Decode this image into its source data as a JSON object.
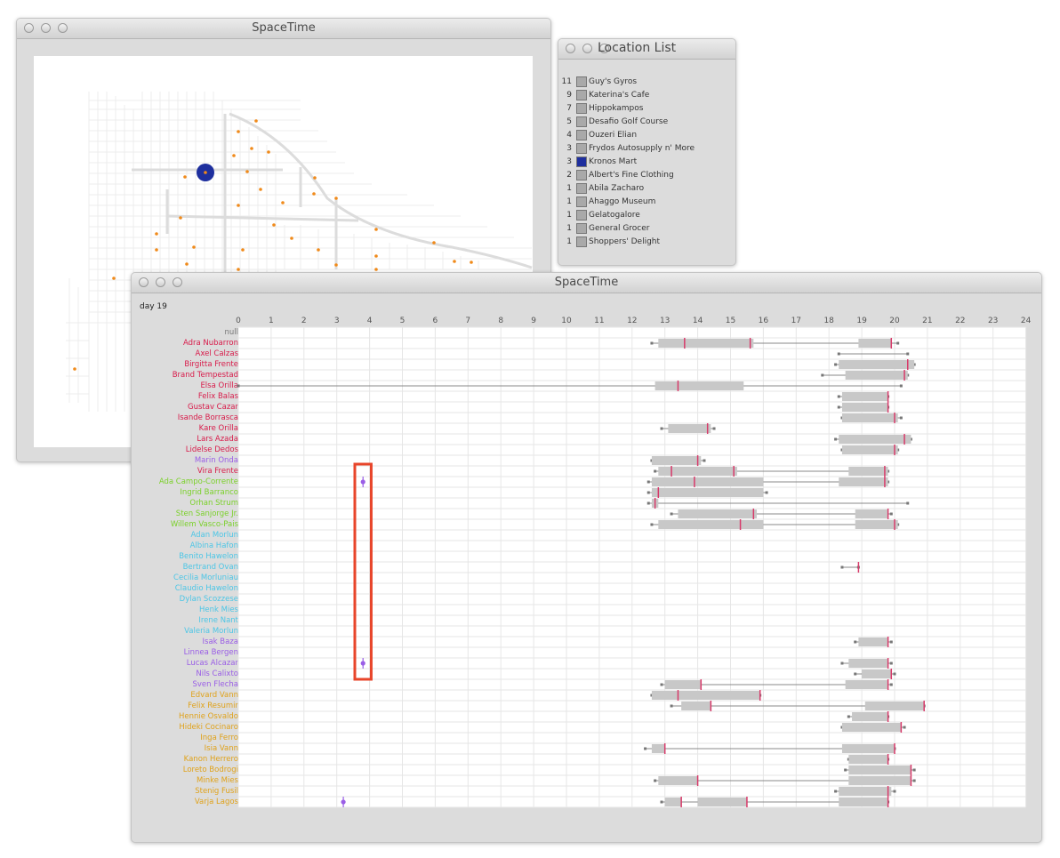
{
  "map_window": {
    "title": "SpaceTime"
  },
  "location_window": {
    "title": "Location List",
    "items": [
      {
        "count": "11",
        "name": "Guy's Gyros",
        "selected": false
      },
      {
        "count": "9",
        "name": "Katerina's Cafe",
        "selected": false
      },
      {
        "count": "7",
        "name": "Hippokampos",
        "selected": false
      },
      {
        "count": "5",
        "name": "Desafio Golf Course",
        "selected": false
      },
      {
        "count": "4",
        "name": "Ouzeri Elian",
        "selected": false
      },
      {
        "count": "3",
        "name": "Frydos Autosupply n' More",
        "selected": false
      },
      {
        "count": "3",
        "name": "Kronos Mart",
        "selected": true
      },
      {
        "count": "2",
        "name": "Albert's Fine Clothing",
        "selected": false
      },
      {
        "count": "1",
        "name": "Abila Zacharo",
        "selected": false
      },
      {
        "count": "1",
        "name": "Ahaggo Museum",
        "selected": false
      },
      {
        "count": "1",
        "name": "Gelatogalore",
        "selected": false
      },
      {
        "count": "1",
        "name": "General Grocer",
        "selected": false
      },
      {
        "count": "1",
        "name": "Shoppers' Delight",
        "selected": false
      }
    ]
  },
  "timeline_window": {
    "title": "SpaceTime",
    "day_label": "day 19",
    "hours": [
      "0",
      "1",
      "2",
      "3",
      "4",
      "5",
      "6",
      "7",
      "8",
      "9",
      "10",
      "11",
      "12",
      "13",
      "14",
      "15",
      "16",
      "17",
      "18",
      "19",
      "20",
      "21",
      "22",
      "23",
      "24"
    ],
    "colors": {
      "red": "#d81b4a",
      "green": "#7bd12a",
      "cyan": "#4cc6e6",
      "purple": "#9a5ee6",
      "orange": "#e0a21a",
      "null": "#777777",
      "highlight": "#e8452a",
      "bar": "#c8c8c8",
      "marker": "#d83a6a",
      "selected": "#1e2f9e"
    },
    "rows": [
      {
        "name": "null",
        "color": "null",
        "bars": [],
        "ticks": [],
        "line": []
      },
      {
        "name": "Adra Nubarron",
        "color": "red",
        "bars": [
          [
            12.8,
            15.7
          ],
          [
            18.9,
            19.9
          ]
        ],
        "ticks": [
          13.6,
          15.6,
          19.9
        ],
        "line": [
          12.6,
          20.1
        ]
      },
      {
        "name": "Axel Calzas",
        "color": "red",
        "bars": [],
        "ticks": [],
        "line": [
          18.3,
          20.4
        ]
      },
      {
        "name": "Birgitta Frente",
        "color": "red",
        "bars": [
          [
            18.3,
            20.6
          ]
        ],
        "ticks": [
          20.4
        ],
        "line": [
          18.2,
          20.6
        ]
      },
      {
        "name": "Brand Tempestad",
        "color": "red",
        "bars": [
          [
            18.5,
            20.4
          ]
        ],
        "ticks": [
          20.3
        ],
        "line": [
          17.8,
          20.4
        ]
      },
      {
        "name": "Elsa Orilla",
        "color": "red",
        "bars": [
          [
            12.7,
            15.4
          ]
        ],
        "ticks": [
          13.4
        ],
        "line": [
          0.0,
          20.2
        ]
      },
      {
        "name": "Felix Balas",
        "color": "red",
        "bars": [
          [
            18.4,
            19.8
          ]
        ],
        "ticks": [
          19.8
        ],
        "line": [
          18.3,
          19.8
        ]
      },
      {
        "name": "Gustav Cazar",
        "color": "red",
        "bars": [
          [
            18.4,
            19.8
          ]
        ],
        "ticks": [
          19.8
        ],
        "line": [
          18.3,
          19.8
        ]
      },
      {
        "name": "Isande Borrasca",
        "color": "red",
        "bars": [
          [
            18.4,
            20.1
          ]
        ],
        "ticks": [
          20.0
        ],
        "line": [
          18.4,
          20.2
        ]
      },
      {
        "name": "Kare Orilla",
        "color": "red",
        "bars": [
          [
            13.1,
            14.4
          ]
        ],
        "ticks": [
          14.3
        ],
        "line": [
          12.9,
          14.5
        ]
      },
      {
        "name": "Lars Azada",
        "color": "red",
        "bars": [
          [
            18.3,
            20.5
          ]
        ],
        "ticks": [
          20.3
        ],
        "line": [
          18.2,
          20.5
        ]
      },
      {
        "name": "Lidelse Dedos",
        "color": "red",
        "bars": [
          [
            18.4,
            20.1
          ]
        ],
        "ticks": [
          20.0
        ],
        "line": [
          18.4,
          20.1
        ]
      },
      {
        "name": "Marin Onda",
        "color": "purple",
        "bars": [
          [
            12.6,
            14.1
          ]
        ],
        "ticks": [
          14.0
        ],
        "line": [
          12.6,
          14.2
        ]
      },
      {
        "name": "Vira Frente",
        "color": "red",
        "bars": [
          [
            12.8,
            15.2
          ],
          [
            18.6,
            19.8
          ]
        ],
        "ticks": [
          13.2,
          15.1,
          19.7
        ],
        "line": [
          12.7,
          19.8
        ]
      },
      {
        "name": "Ada Campo-Corrente",
        "color": "green",
        "bars": [
          [
            12.6,
            16.0
          ],
          [
            18.3,
            19.8
          ]
        ],
        "ticks": [
          13.9,
          19.7
        ],
        "line": [
          12.5,
          19.8
        ],
        "point": 3.8
      },
      {
        "name": "Ingrid Barranco",
        "color": "green",
        "bars": [
          [
            12.6,
            16.0
          ]
        ],
        "ticks": [
          12.8
        ],
        "line": [
          12.5,
          16.1
        ]
      },
      {
        "name": "Orhan Strum",
        "color": "green",
        "bars": [
          [
            12.6,
            12.8
          ]
        ],
        "ticks": [
          12.7
        ],
        "line": [
          12.5,
          20.4
        ]
      },
      {
        "name": "Sten Sanjorge Jr.",
        "color": "green",
        "bars": [
          [
            13.4,
            15.8
          ],
          [
            18.8,
            19.8
          ]
        ],
        "ticks": [
          15.7,
          19.8
        ],
        "line": [
          13.2,
          19.9
        ]
      },
      {
        "name": "Willem Vasco-Pais",
        "color": "green",
        "bars": [
          [
            12.8,
            16.0
          ],
          [
            18.8,
            20.1
          ]
        ],
        "ticks": [
          15.3,
          20.0
        ],
        "line": [
          12.6,
          20.1
        ]
      },
      {
        "name": "Adan Morlun",
        "color": "cyan",
        "bars": [],
        "ticks": [],
        "line": []
      },
      {
        "name": "Albina Hafon",
        "color": "cyan",
        "bars": [],
        "ticks": [],
        "line": []
      },
      {
        "name": "Benito Hawelon",
        "color": "cyan",
        "bars": [],
        "ticks": [],
        "line": []
      },
      {
        "name": "Bertrand Ovan",
        "color": "cyan",
        "bars": [],
        "ticks": [
          18.9
        ],
        "line": [
          18.4,
          18.9
        ]
      },
      {
        "name": "Cecilia Morluniau",
        "color": "cyan",
        "bars": [],
        "ticks": [],
        "line": []
      },
      {
        "name": "Claudio Hawelon",
        "color": "cyan",
        "bars": [],
        "ticks": [],
        "line": []
      },
      {
        "name": "Dylan Scozzese",
        "color": "cyan",
        "bars": [],
        "ticks": [],
        "line": []
      },
      {
        "name": "Henk Mies",
        "color": "cyan",
        "bars": [],
        "ticks": [],
        "line": []
      },
      {
        "name": "Irene Nant",
        "color": "cyan",
        "bars": [],
        "ticks": [],
        "line": []
      },
      {
        "name": "Valeria Morlun",
        "color": "cyan",
        "bars": [],
        "ticks": [],
        "line": []
      },
      {
        "name": "Isak Baza",
        "color": "purple",
        "bars": [
          [
            18.9,
            19.8
          ]
        ],
        "ticks": [
          19.8
        ],
        "line": [
          18.8,
          19.9
        ]
      },
      {
        "name": "Linnea Bergen",
        "color": "purple",
        "bars": [],
        "ticks": [],
        "line": []
      },
      {
        "name": "Lucas Alcazar",
        "color": "purple",
        "bars": [
          [
            18.6,
            19.8
          ]
        ],
        "ticks": [
          19.8
        ],
        "line": [
          18.4,
          19.9
        ],
        "point": 3.8
      },
      {
        "name": "Nils Calixto",
        "color": "purple",
        "bars": [
          [
            19.0,
            19.9
          ]
        ],
        "ticks": [
          19.9
        ],
        "line": [
          18.8,
          20.0
        ]
      },
      {
        "name": "Sven Flecha",
        "color": "purple",
        "bars": [
          [
            13.0,
            14.1
          ],
          [
            18.5,
            19.8
          ]
        ],
        "ticks": [
          14.1,
          19.8
        ],
        "line": [
          12.9,
          19.9
        ]
      },
      {
        "name": "Edvard Vann",
        "color": "orange",
        "bars": [
          [
            12.6,
            15.9
          ]
        ],
        "ticks": [
          13.4,
          15.9
        ],
        "line": [
          12.6,
          15.9
        ]
      },
      {
        "name": "Felix Resumir",
        "color": "orange",
        "bars": [
          [
            13.5,
            14.4
          ],
          [
            19.1,
            20.9
          ]
        ],
        "ticks": [
          14.4,
          20.9
        ],
        "line": [
          13.2,
          20.9
        ]
      },
      {
        "name": "Hennie Osvaldo",
        "color": "orange",
        "bars": [
          [
            18.7,
            19.8
          ]
        ],
        "ticks": [
          19.8
        ],
        "line": [
          18.6,
          19.8
        ]
      },
      {
        "name": "Hideki Cocinaro",
        "color": "orange",
        "bars": [
          [
            18.4,
            20.2
          ]
        ],
        "ticks": [
          20.2
        ],
        "line": [
          18.4,
          20.3
        ]
      },
      {
        "name": "Inga Ferro",
        "color": "orange",
        "bars": [],
        "ticks": [],
        "line": []
      },
      {
        "name": "Isia Vann",
        "color": "orange",
        "bars": [
          [
            12.6,
            13.0
          ],
          [
            18.4,
            20.0
          ]
        ],
        "ticks": [
          13.0,
          20.0
        ],
        "line": [
          12.4,
          20.0
        ]
      },
      {
        "name": "Kanon Herrero",
        "color": "orange",
        "bars": [
          [
            18.6,
            19.8
          ]
        ],
        "ticks": [
          19.8
        ],
        "line": [
          18.6,
          19.8
        ]
      },
      {
        "name": "Loreto Bodrogi",
        "color": "orange",
        "bars": [
          [
            18.6,
            20.5
          ]
        ],
        "ticks": [
          20.5
        ],
        "line": [
          18.5,
          20.6
        ]
      },
      {
        "name": "Minke Mies",
        "color": "orange",
        "bars": [
          [
            12.8,
            14.0
          ],
          [
            18.6,
            20.5
          ]
        ],
        "ticks": [
          14.0,
          20.5
        ],
        "line": [
          12.7,
          20.6
        ]
      },
      {
        "name": "Stenig Fusil",
        "color": "orange",
        "bars": [
          [
            18.3,
            19.9
          ]
        ],
        "ticks": [
          19.8
        ],
        "line": [
          18.2,
          20.0
        ]
      },
      {
        "name": "Varja Lagos",
        "color": "orange",
        "bars": [
          [
            13.0,
            13.5
          ],
          [
            14.0,
            15.5
          ],
          [
            18.3,
            19.8
          ]
        ],
        "ticks": [
          13.5,
          15.5,
          19.8
        ],
        "line": [
          12.9,
          19.8
        ],
        "point": 3.2
      }
    ]
  }
}
